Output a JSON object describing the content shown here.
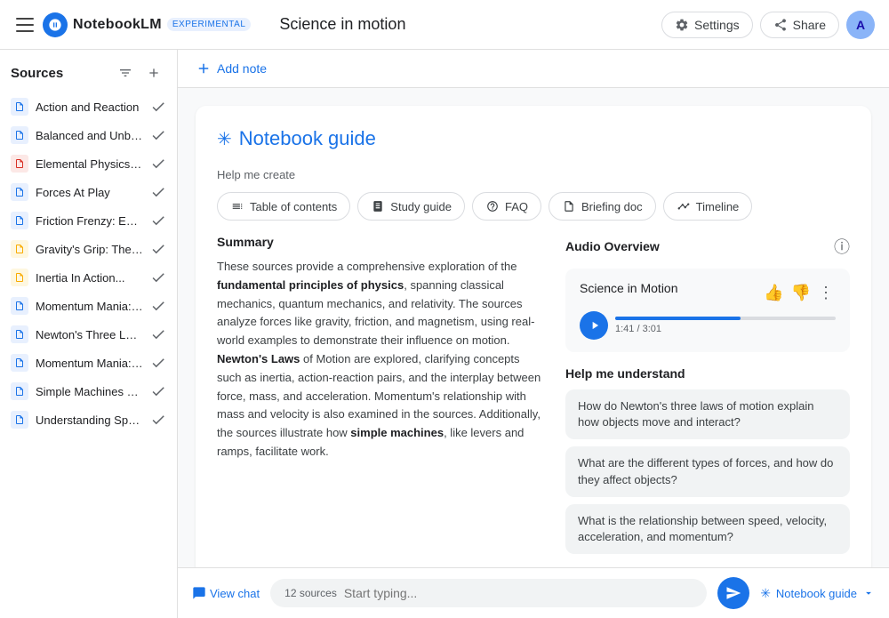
{
  "brand": {
    "logo_text": "NL",
    "name": "NotebookLM",
    "badge": "EXPERIMENTAL"
  },
  "header": {
    "title": "Science in motion",
    "settings_label": "Settings",
    "share_label": "Share",
    "avatar_initials": "A"
  },
  "sidebar": {
    "title": "Sources",
    "filter_icon": "≡",
    "add_icon": "+",
    "sources": [
      {
        "label": "Action and Reaction",
        "icon_type": "blue",
        "icon": "▤"
      },
      {
        "label": "Balanced and Unbalance...",
        "icon_type": "blue",
        "icon": "▤"
      },
      {
        "label": "Elemental Physics, Third...",
        "icon_type": "red",
        "icon": "▤"
      },
      {
        "label": "Forces At Play",
        "icon_type": "blue",
        "icon": "▤"
      },
      {
        "label": "Friction Frenzy: Explorin...",
        "icon_type": "blue",
        "icon": "▤"
      },
      {
        "label": "Gravity's Grip: The Force...",
        "icon_type": "yellow",
        "icon": "▤"
      },
      {
        "label": "Inertia In Action...",
        "icon_type": "yellow",
        "icon": "▤"
      },
      {
        "label": "Momentum Mania: Inves...",
        "icon_type": "blue",
        "icon": "▤"
      },
      {
        "label": "Newton's Three Laws...",
        "icon_type": "blue",
        "icon": "▤"
      },
      {
        "label": "Momentum Mania: Inves...",
        "icon_type": "blue",
        "icon": "▤"
      },
      {
        "label": "Simple Machines Make...",
        "icon_type": "blue",
        "icon": "▤"
      },
      {
        "label": "Understanding Speed, Ve...",
        "icon_type": "blue",
        "icon": "▤"
      }
    ]
  },
  "content": {
    "add_note_label": "Add note"
  },
  "guide": {
    "sparkle": "✳",
    "title": "Notebook guide",
    "help_create_label": "Help me create",
    "chips": [
      {
        "id": "toc",
        "icon": "☰",
        "label": "Table of contents"
      },
      {
        "id": "study",
        "icon": "📖",
        "label": "Study guide"
      },
      {
        "id": "faq",
        "icon": "❓",
        "label": "FAQ"
      },
      {
        "id": "briefing",
        "icon": "📄",
        "label": "Briefing doc"
      },
      {
        "id": "timeline",
        "icon": "📅",
        "label": "Timeline"
      }
    ],
    "summary_title": "Summary",
    "summary_text": "These sources provide a comprehensive exploration of the fundamental principles of physics, spanning classical mechanics, quantum mechanics, and relativity. The sources analyze forces like gravity, friction, and magnetism, using real-world examples to demonstrate their influence on motion. Newton's Laws of Motion are explored, clarifying concepts such as inertia, action-reaction pairs, and the interplay between force, mass, and acceleration. Momentum's relationship with mass and velocity is also examined in the sources. Additionally, the sources illustrate how simple machines, like levers and ramps, facilitate work.",
    "summary_bold_phrases": [
      "fundamental principles of physics",
      "Newton's Laws",
      "simple machines"
    ],
    "audio_overview_title": "Audio Overview",
    "audio_title": "Science in Motion",
    "audio_progress_percent": 57,
    "audio_time": "1:41 / 3:01",
    "help_understand_title": "Help me understand",
    "understand_chips": [
      "How do Newton's three laws of motion explain how objects move and interact?",
      "What are the different types of forces, and how do they affect objects?",
      "What is the relationship between speed, velocity, acceleration, and momentum?"
    ]
  },
  "bottom_bar": {
    "view_chat_label": "View chat",
    "sources_count": "12 sources",
    "input_placeholder": "Start typing...",
    "notebook_guide_label": "Notebook guide"
  }
}
